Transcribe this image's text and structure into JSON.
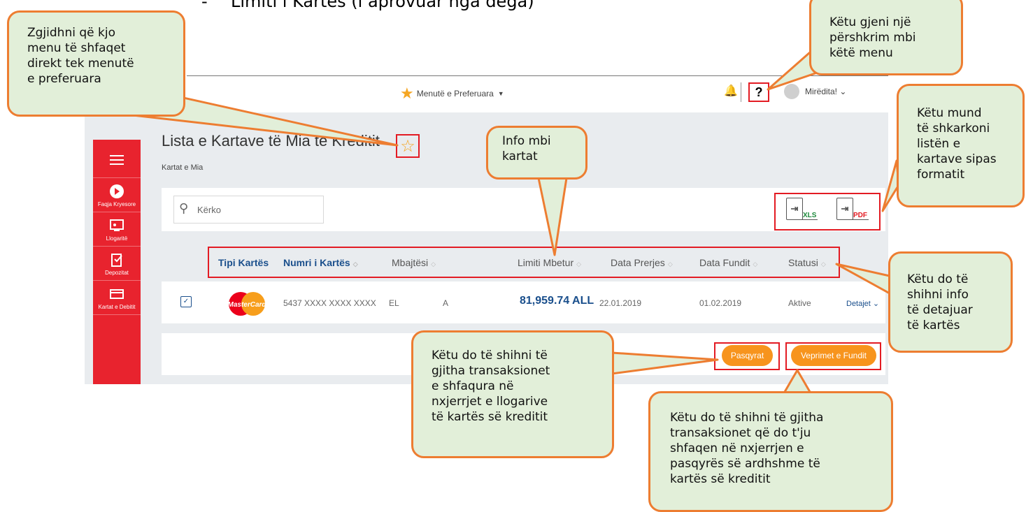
{
  "document": {
    "heading": "Limiti i Kartës (i aprovuar nga dega)",
    "bullet": "-"
  },
  "topbar": {
    "favorites_label": "Menutë e Preferuara",
    "help": "?",
    "greeting": "Mirëdita!"
  },
  "sidebar": {
    "items": [
      {
        "label": "Faqja Kryesore",
        "icon": "home-icon"
      },
      {
        "label": "Llogaritë",
        "icon": "accounts-icon"
      },
      {
        "label": "Depozitat",
        "icon": "deposits-icon"
      },
      {
        "label": "Kartat e Debitit",
        "icon": "debit-card-icon"
      }
    ]
  },
  "page": {
    "title": "Lista e Kartave të Mia të Kreditit",
    "breadcrumb": "Kartat e Mia"
  },
  "search": {
    "placeholder": "Kërko"
  },
  "downloads": {
    "xls": "XLS",
    "pdf": "PDF"
  },
  "table": {
    "headers": [
      "Tipi Kartës",
      "Numri i Kartës",
      "Mbajtësi",
      "Limiti Mbetur",
      "Data Prerjes",
      "Data Fundit",
      "Statusi"
    ],
    "row": {
      "card_brand": "MasterCard",
      "number": "5437 XXXX XXXX XXXX",
      "holder_first": "EL",
      "holder_second": "A",
      "limit": "81,959.74 ALL",
      "cut_date": "22.01.2019",
      "due_date": "01.02.2019",
      "status": "Aktive",
      "details": "Detajet"
    }
  },
  "buttons": {
    "statements": "Pasqyrat",
    "recent": "Veprimet e Fundit"
  },
  "callouts": {
    "favorite": [
      "Zgjidhni që kjo",
      "menu të shfaqet",
      "direkt tek menutë",
      "e preferuara"
    ],
    "help": [
      "Këtu gjeni një",
      "përshkrim mbi",
      "këtë menu"
    ],
    "download": [
      "Këtu mund",
      "të shkarkoni",
      "listën e",
      "kartave sipas",
      "formatit"
    ],
    "info": [
      "Info mbi",
      "kartat"
    ],
    "details": [
      "Këtu do të",
      "shihni info",
      "të detajuar",
      "të kartës"
    ],
    "statements": [
      "Këtu do të shihni të",
      "gjitha transaksionet",
      "e shfaqura në",
      "nxjerrjet e llogarive",
      "të kartës së kreditit"
    ],
    "recent": [
      "Këtu do të shihni të gjitha",
      "transaksionet që do t'ju",
      "shfaqen në nxjerrjen e",
      "pasqyrës së ardhshme të",
      "kartës së kreditit"
    ]
  },
  "colors": {
    "brand_red": "#e8232e",
    "accent_orange": "#f7941d",
    "callout_fill": "#e2efd9",
    "callout_border": "#ed7d31",
    "link_blue": "#1a4f8c"
  }
}
